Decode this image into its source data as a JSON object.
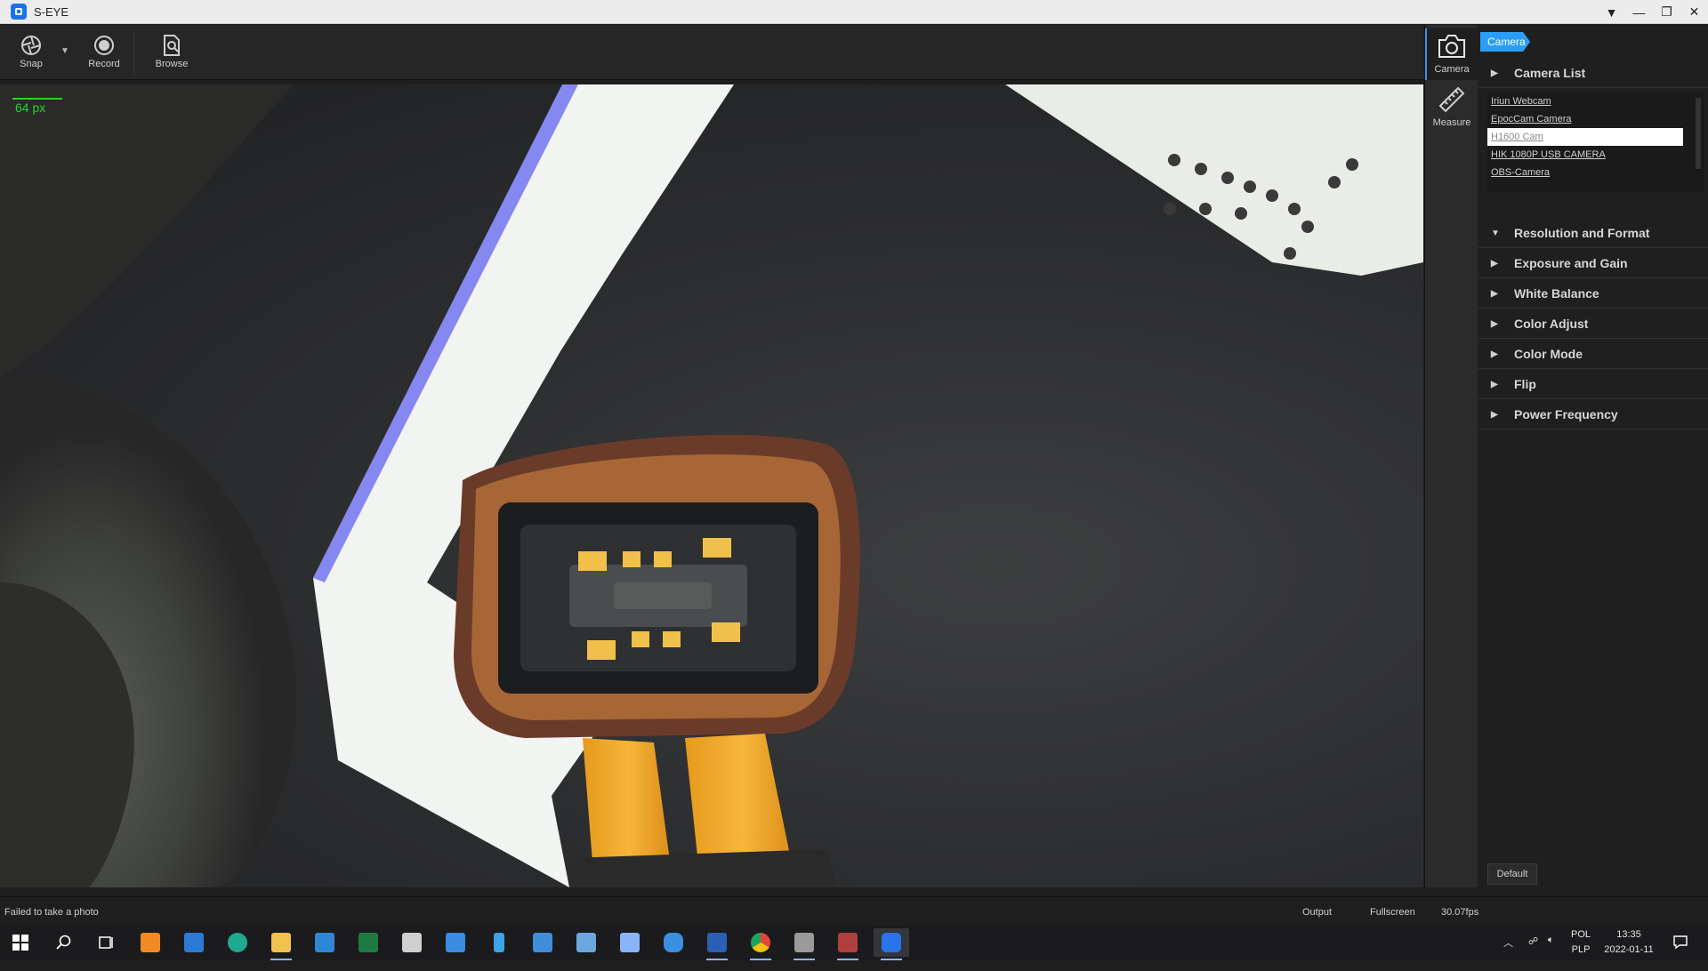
{
  "window": {
    "title": "S-EYE"
  },
  "toolbar": {
    "snap": "Snap",
    "record": "Record",
    "browse": "Browse"
  },
  "viewport": {
    "scale": "64 px"
  },
  "rail": {
    "camera": "Camera",
    "measure": "Measure"
  },
  "panel": {
    "tag": "Camera",
    "camera_list_label": "Camera List",
    "cameras": [
      "Iriun Webcam",
      "EpocCam Camera",
      "H1600 Cam",
      "HIK 1080P USB CAMERA",
      "OBS-Camera"
    ],
    "selected_camera": "H1600 Cam",
    "sections": [
      "Resolution and Format",
      "Exposure and Gain",
      "White Balance",
      "Color Adjust",
      "Color Mode",
      "Flip",
      "Power Frequency"
    ],
    "default_label": "Default"
  },
  "status": {
    "message": "Failed to take a photo",
    "output": "Output",
    "fullscreen": "Fullscreen",
    "fps": "30.07fps"
  },
  "taskbar": {
    "lang": "POL",
    "layout": "PLP",
    "time": "13:35",
    "date": "2022-01-11",
    "apps": [
      {
        "name": "start",
        "color": "#ffffff"
      },
      {
        "name": "search",
        "color": "#ffffff"
      },
      {
        "name": "task-view",
        "color": "#ffffff"
      },
      {
        "name": "media-player",
        "color": "#f08a24"
      },
      {
        "name": "store",
        "color": "#2b7bd6"
      },
      {
        "name": "edge",
        "color": "#1faa8f"
      },
      {
        "name": "file-explorer",
        "color": "#f2c14e"
      },
      {
        "name": "mail",
        "color": "#2f86d6"
      },
      {
        "name": "excel",
        "color": "#1e7a45"
      },
      {
        "name": "camera",
        "color": "#cfcfcf"
      },
      {
        "name": "calculator",
        "color": "#3b8be0"
      },
      {
        "name": "phone",
        "color": "#3da3e6"
      },
      {
        "name": "chart-app",
        "color": "#3e8ed9"
      },
      {
        "name": "tool-app",
        "color": "#6ba6de"
      },
      {
        "name": "scanner",
        "color": "#8ab4f8"
      },
      {
        "name": "onedrive",
        "color": "#3a8fe0"
      },
      {
        "name": "word",
        "color": "#2b5fb4"
      },
      {
        "name": "chrome",
        "color": "#e0463a"
      },
      {
        "name": "capture",
        "color": "#9a9a9a"
      },
      {
        "name": "film",
        "color": "#b04040"
      },
      {
        "name": "s-eye",
        "color": "#2a73e8"
      }
    ]
  }
}
